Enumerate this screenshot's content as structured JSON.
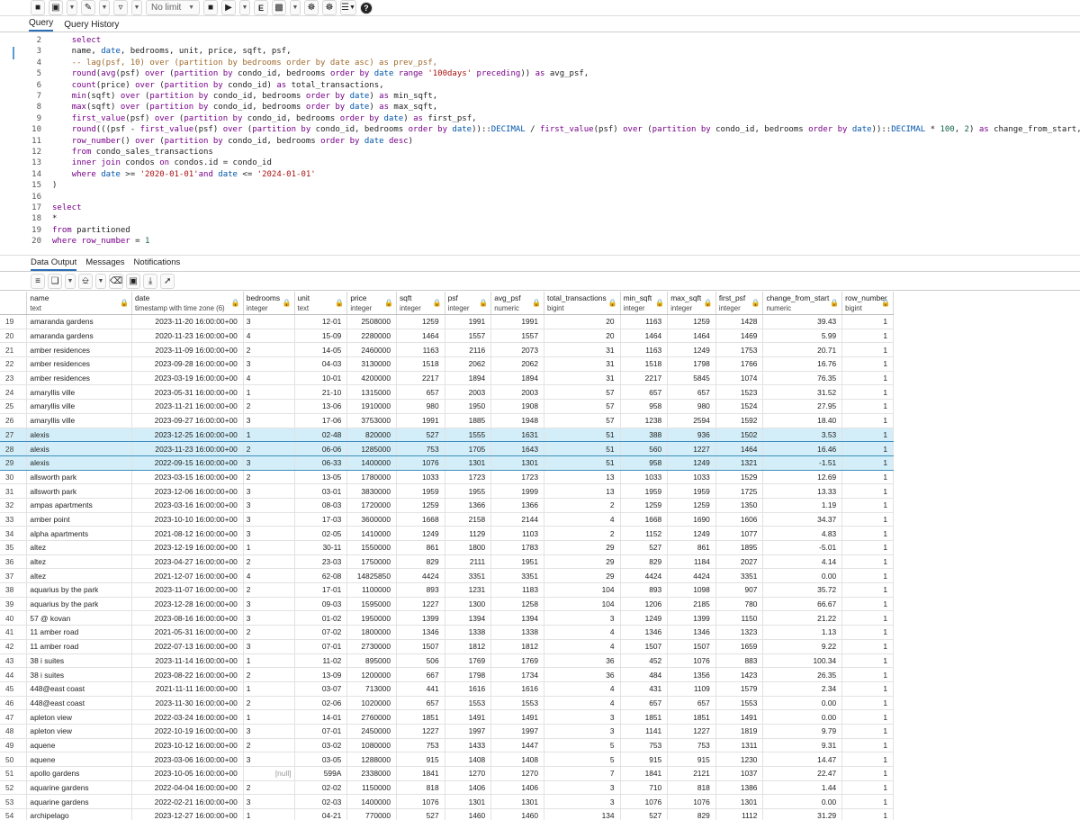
{
  "toolbar": {
    "limit_label": "No limit",
    "colors": {
      "accent": "#2a6fb8",
      "selection": "#d3eef8"
    }
  },
  "query_tabs": [
    "Query",
    "Query History"
  ],
  "editor": {
    "line_numbers": [
      "2",
      "3",
      "4",
      "5",
      "6",
      "7",
      "8",
      "9",
      "10",
      "11",
      "12",
      "13",
      "14",
      "15",
      "16",
      "17",
      "18",
      "19",
      "20"
    ],
    "lines": [
      "    select",
      "    name, date, bedrooms, unit, price, sqft, psf,",
      "    -- lag(psf, 10) over (partition by bedrooms order by date asc) as prev_psf,",
      "    round(avg(psf) over (partition by condo_id, bedrooms order by date range '100days' preceding)) as avg_psf,",
      "    count(price) over (partition by condo_id) as total_transactions,",
      "    min(sqft) over (partition by condo_id, bedrooms order by date) as min_sqft,",
      "    max(sqft) over (partition by condo_id, bedrooms order by date) as max_sqft,",
      "    first_value(psf) over (partition by condo_id, bedrooms order by date) as first_psf,",
      "    round(((psf - first_value(psf) over (partition by condo_id, bedrooms order by date))::DECIMAL / first_value(psf) over (partition by condo_id, bedrooms order by date))::DECIMAL * 100, 2) as change_from_start,",
      "    row_number() over (partition by condo_id, bedrooms order by date desc)",
      "    from condo_sales_transactions",
      "    inner join condos on condos.id = condo_id",
      "    where date >= '2020-01-01'and date <= '2024-01-01'",
      ")",
      "",
      "select",
      "*",
      "from partitioned",
      "where row_number = 1"
    ]
  },
  "output_tabs": [
    "Data Output",
    "Messages",
    "Notifications"
  ],
  "columns": [
    {
      "name": "name",
      "type": "text"
    },
    {
      "name": "date",
      "type": "timestamp with time zone (6)"
    },
    {
      "name": "bedrooms",
      "type": "integer"
    },
    {
      "name": "unit",
      "type": "text"
    },
    {
      "name": "price",
      "type": "integer"
    },
    {
      "name": "sqft",
      "type": "integer"
    },
    {
      "name": "psf",
      "type": "integer"
    },
    {
      "name": "avg_psf",
      "type": "numeric"
    },
    {
      "name": "total_transactions",
      "type": "bigint"
    },
    {
      "name": "min_sqft",
      "type": "integer"
    },
    {
      "name": "max_sqft",
      "type": "integer"
    },
    {
      "name": "first_psf",
      "type": "integer"
    },
    {
      "name": "change_from_start",
      "type": "numeric"
    },
    {
      "name": "row_number",
      "type": "bigint"
    }
  ],
  "selected_rows": [
    "27",
    "28",
    "29"
  ],
  "rows": [
    [
      "19",
      "amaranda gardens",
      "2023-11-20 16:00:00+00",
      "3",
      "12-01",
      "2508000",
      "1259",
      "1991",
      "1991",
      "20",
      "1163",
      "1259",
      "1428",
      "39.43",
      "1"
    ],
    [
      "20",
      "amaranda gardens",
      "2020-11-23 16:00:00+00",
      "4",
      "15-09",
      "2280000",
      "1464",
      "1557",
      "1557",
      "20",
      "1464",
      "1464",
      "1469",
      "5.99",
      "1"
    ],
    [
      "21",
      "amber residences",
      "2023-11-09 16:00:00+00",
      "2",
      "14-05",
      "2460000",
      "1163",
      "2116",
      "2073",
      "31",
      "1163",
      "1249",
      "1753",
      "20.71",
      "1"
    ],
    [
      "22",
      "amber residences",
      "2023-09-28 16:00:00+00",
      "3",
      "04-03",
      "3130000",
      "1518",
      "2062",
      "2062",
      "31",
      "1518",
      "1798",
      "1766",
      "16.76",
      "1"
    ],
    [
      "23",
      "amber residences",
      "2023-03-19 16:00:00+00",
      "4",
      "10-01",
      "4200000",
      "2217",
      "1894",
      "1894",
      "31",
      "2217",
      "5845",
      "1074",
      "76.35",
      "1"
    ],
    [
      "24",
      "amaryllis ville",
      "2023-05-31 16:00:00+00",
      "1",
      "21-10",
      "1315000",
      "657",
      "2003",
      "2003",
      "57",
      "657",
      "657",
      "1523",
      "31.52",
      "1"
    ],
    [
      "25",
      "amaryllis ville",
      "2023-11-21 16:00:00+00",
      "2",
      "13-06",
      "1910000",
      "980",
      "1950",
      "1908",
      "57",
      "958",
      "980",
      "1524",
      "27.95",
      "1"
    ],
    [
      "26",
      "amaryllis ville",
      "2023-09-27 16:00:00+00",
      "3",
      "17-06",
      "3753000",
      "1991",
      "1885",
      "1948",
      "57",
      "1238",
      "2594",
      "1592",
      "18.40",
      "1"
    ],
    [
      "27",
      "alexis",
      "2023-12-25 16:00:00+00",
      "1",
      "02-48",
      "820000",
      "527",
      "1555",
      "1631",
      "51",
      "388",
      "936",
      "1502",
      "3.53",
      "1"
    ],
    [
      "28",
      "alexis",
      "2023-11-23 16:00:00+00",
      "2",
      "06-06",
      "1285000",
      "753",
      "1705",
      "1643",
      "51",
      "560",
      "1227",
      "1464",
      "16.46",
      "1"
    ],
    [
      "29",
      "alexis",
      "2022-09-15 16:00:00+00",
      "3",
      "06-33",
      "1400000",
      "1076",
      "1301",
      "1301",
      "51",
      "958",
      "1249",
      "1321",
      "-1.51",
      "1"
    ],
    [
      "30",
      "allsworth park",
      "2023-03-15 16:00:00+00",
      "2",
      "13-05",
      "1780000",
      "1033",
      "1723",
      "1723",
      "13",
      "1033",
      "1033",
      "1529",
      "12.69",
      "1"
    ],
    [
      "31",
      "allsworth park",
      "2023-12-06 16:00:00+00",
      "3",
      "03-01",
      "3830000",
      "1959",
      "1955",
      "1999",
      "13",
      "1959",
      "1959",
      "1725",
      "13.33",
      "1"
    ],
    [
      "32",
      "ampas apartments",
      "2023-03-16 16:00:00+00",
      "3",
      "08-03",
      "1720000",
      "1259",
      "1366",
      "1366",
      "2",
      "1259",
      "1259",
      "1350",
      "1.19",
      "1"
    ],
    [
      "33",
      "amber point",
      "2023-10-10 16:00:00+00",
      "3",
      "17-03",
      "3600000",
      "1668",
      "2158",
      "2144",
      "4",
      "1668",
      "1690",
      "1606",
      "34.37",
      "1"
    ],
    [
      "34",
      "alpha apartments",
      "2021-08-12 16:00:00+00",
      "3",
      "02-05",
      "1410000",
      "1249",
      "1129",
      "1103",
      "2",
      "1152",
      "1249",
      "1077",
      "4.83",
      "1"
    ],
    [
      "35",
      "altez",
      "2023-12-19 16:00:00+00",
      "1",
      "30-11",
      "1550000",
      "861",
      "1800",
      "1783",
      "29",
      "527",
      "861",
      "1895",
      "-5.01",
      "1"
    ],
    [
      "36",
      "altez",
      "2023-04-27 16:00:00+00",
      "2",
      "23-03",
      "1750000",
      "829",
      "2111",
      "1951",
      "29",
      "829",
      "1184",
      "2027",
      "4.14",
      "1"
    ],
    [
      "37",
      "altez",
      "2021-12-07 16:00:00+00",
      "4",
      "62-08",
      "14825850",
      "4424",
      "3351",
      "3351",
      "29",
      "4424",
      "4424",
      "3351",
      "0.00",
      "1"
    ],
    [
      "38",
      "aquarius by the park",
      "2023-11-07 16:00:00+00",
      "2",
      "17-01",
      "1100000",
      "893",
      "1231",
      "1183",
      "104",
      "893",
      "1098",
      "907",
      "35.72",
      "1"
    ],
    [
      "39",
      "aquarius by the park",
      "2023-12-28 16:00:00+00",
      "3",
      "09-03",
      "1595000",
      "1227",
      "1300",
      "1258",
      "104",
      "1206",
      "2185",
      "780",
      "66.67",
      "1"
    ],
    [
      "40",
      "57 @ kovan",
      "2023-08-16 16:00:00+00",
      "3",
      "01-02",
      "1950000",
      "1399",
      "1394",
      "1394",
      "3",
      "1249",
      "1399",
      "1150",
      "21.22",
      "1"
    ],
    [
      "41",
      "11 amber road",
      "2021-05-31 16:00:00+00",
      "2",
      "07-02",
      "1800000",
      "1346",
      "1338",
      "1338",
      "4",
      "1346",
      "1346",
      "1323",
      "1.13",
      "1"
    ],
    [
      "42",
      "11 amber road",
      "2022-07-13 16:00:00+00",
      "3",
      "07-01",
      "2730000",
      "1507",
      "1812",
      "1812",
      "4",
      "1507",
      "1507",
      "1659",
      "9.22",
      "1"
    ],
    [
      "43",
      "38 i suites",
      "2023-11-14 16:00:00+00",
      "1",
      "11-02",
      "895000",
      "506",
      "1769",
      "1769",
      "36",
      "452",
      "1076",
      "883",
      "100.34",
      "1"
    ],
    [
      "44",
      "38 i suites",
      "2023-08-22 16:00:00+00",
      "2",
      "13-09",
      "1200000",
      "667",
      "1798",
      "1734",
      "36",
      "484",
      "1356",
      "1423",
      "26.35",
      "1"
    ],
    [
      "45",
      "448@east coast",
      "2021-11-11 16:00:00+00",
      "1",
      "03-07",
      "713000",
      "441",
      "1616",
      "1616",
      "4",
      "431",
      "1109",
      "1579",
      "2.34",
      "1"
    ],
    [
      "46",
      "448@east coast",
      "2023-11-30 16:00:00+00",
      "2",
      "02-06",
      "1020000",
      "657",
      "1553",
      "1553",
      "4",
      "657",
      "657",
      "1553",
      "0.00",
      "1"
    ],
    [
      "47",
      "apleton view",
      "2022-03-24 16:00:00+00",
      "1",
      "14-01",
      "2760000",
      "1851",
      "1491",
      "1491",
      "3",
      "1851",
      "1851",
      "1491",
      "0.00",
      "1"
    ],
    [
      "48",
      "apleton view",
      "2022-10-19 16:00:00+00",
      "3",
      "07-01",
      "2450000",
      "1227",
      "1997",
      "1997",
      "3",
      "1141",
      "1227",
      "1819",
      "9.79",
      "1"
    ],
    [
      "49",
      "aquene",
      "2023-10-12 16:00:00+00",
      "2",
      "03-02",
      "1080000",
      "753",
      "1433",
      "1447",
      "5",
      "753",
      "753",
      "1311",
      "9.31",
      "1"
    ],
    [
      "50",
      "aquene",
      "2023-03-06 16:00:00+00",
      "3",
      "03-05",
      "1288000",
      "915",
      "1408",
      "1408",
      "5",
      "915",
      "915",
      "1230",
      "14.47",
      "1"
    ],
    [
      "51",
      "apollo gardens",
      "2023-10-05 16:00:00+00",
      "[null]",
      "599A",
      "2338000",
      "1841",
      "1270",
      "1270",
      "7",
      "1841",
      "2121",
      "1037",
      "22.47",
      "1"
    ],
    [
      "52",
      "aquarine gardens",
      "2022-04-04 16:00:00+00",
      "2",
      "02-02",
      "1150000",
      "818",
      "1406",
      "1406",
      "3",
      "710",
      "818",
      "1386",
      "1.44",
      "1"
    ],
    [
      "53",
      "aquarine gardens",
      "2022-02-21 16:00:00+00",
      "3",
      "02-03",
      "1400000",
      "1076",
      "1301",
      "1301",
      "3",
      "1076",
      "1076",
      "1301",
      "0.00",
      "1"
    ],
    [
      "54",
      "archipelago",
      "2023-12-27 16:00:00+00",
      "1",
      "04-21",
      "770000",
      "527",
      "1460",
      "1460",
      "134",
      "527",
      "829",
      "1112",
      "31.29",
      "1"
    ]
  ]
}
